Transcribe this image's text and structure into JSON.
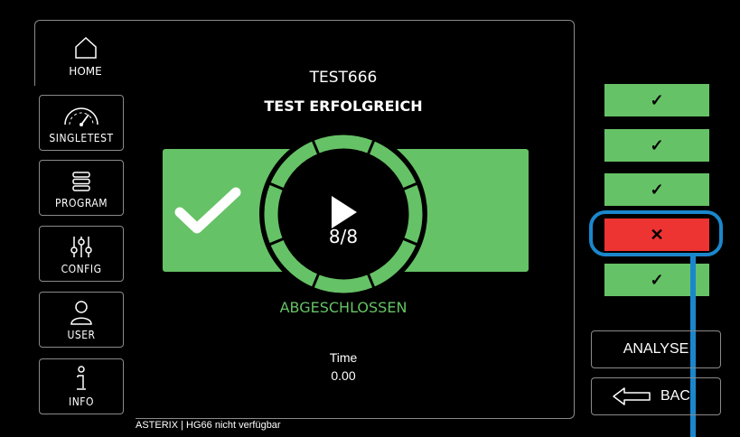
{
  "test": {
    "name": "TEST666",
    "result": "TEST ERFOLGREICH",
    "progress": "8/8",
    "status": "ABGESCHLOSSEN",
    "time_label": "Time",
    "time_value": "0.00",
    "segments_total": 8,
    "segments_done": 8
  },
  "nav": {
    "home": "HOME",
    "singletest": "SINGLETEST",
    "program": "PROGRAM",
    "config": "CONFIG",
    "user": "USER",
    "info": "INFO"
  },
  "results": [
    {
      "symbol": "✓",
      "state": "pass"
    },
    {
      "symbol": "✓",
      "state": "pass"
    },
    {
      "symbol": "✓",
      "state": "pass"
    },
    {
      "symbol": "✕",
      "state": "fail"
    },
    {
      "symbol": "✓",
      "state": "pass"
    }
  ],
  "buttons": {
    "analyse": "ANALYSE",
    "back": "BAC"
  },
  "footer": {
    "status": "ASTERIX | HG66 nicht verfügbar"
  },
  "colors": {
    "pass": "#66c266",
    "fail": "#ee3333",
    "highlight": "#1a87cc",
    "background": "#000000"
  },
  "icons": {
    "home": "home-icon",
    "singletest": "gauge-icon",
    "program": "list-icon",
    "config": "sliders-icon",
    "user": "user-icon",
    "info": "info-icon"
  }
}
